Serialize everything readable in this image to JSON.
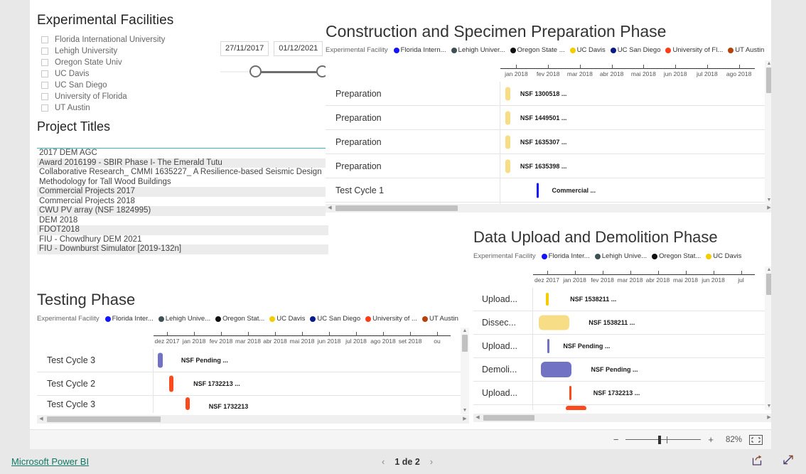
{
  "facilities_slicer": {
    "title": "Experimental Facilities",
    "items": [
      {
        "label": "Florida International University",
        "checked": false
      },
      {
        "label": "Lehigh University",
        "checked": false
      },
      {
        "label": "Oregon State Univ",
        "checked": false
      },
      {
        "label": "UC Davis",
        "checked": false
      },
      {
        "label": "UC San Diego",
        "checked": false
      },
      {
        "label": "University of Florida",
        "checked": false
      },
      {
        "label": "UT Austin",
        "checked": false
      }
    ]
  },
  "date_slicer": {
    "start_date": "27/11/2017",
    "end_date": "01/12/2021"
  },
  "project_titles": {
    "title": "Project Titles",
    "items": [
      "2017 DEM AGC",
      "Award 2016199 - SBIR Phase I- The Emerald Tutu",
      "Collaborative Research_ CMMI 1635227_ A Resilience-based Seismic Design Methodology for Tall Wood Buildings",
      "Commercial Projects 2017",
      "Commercial Projects 2018",
      "CWU PV array (NSF 1824995)",
      "DEM 2018",
      "FDOT2018",
      "FIU - Chowdhury DEM 2021",
      "FIU - Downburst Simulator [2019-132n]"
    ]
  },
  "legend_colors": {
    "florida_international": "#1414ff",
    "lehigh": "#3d5155",
    "oregon_state": "#111111",
    "uc_davis": "#f3cd00",
    "uc_san_diego": "#0a1a8c",
    "university_of_florida": "#fc3c17",
    "ut_austin": "#b5420a",
    "bar_yellow": "#f7de86",
    "bar_blue": "#1414ff",
    "bar_purple": "#7272c4",
    "bar_orange": "#fc4a1f"
  },
  "construction_chart": {
    "title": "Construction and Specimen Preparation Phase",
    "legend_caption": "Experimental Facility",
    "legend": [
      {
        "label": "Florida Intern...",
        "color": "#1414ff"
      },
      {
        "label": "Lehigh Univer...",
        "color": "#3d5155"
      },
      {
        "label": "Oregon State ...",
        "color": "#111111"
      },
      {
        "label": "UC Davis",
        "color": "#f3cd00"
      },
      {
        "label": "UC San Diego",
        "color": "#0a1a8c"
      },
      {
        "label": "University of Fl...",
        "color": "#fc3c17"
      },
      {
        "label": "UT Austin",
        "color": "#b5420a"
      }
    ],
    "axis_ticks": [
      "jan 2018",
      "fev 2018",
      "mar 2018",
      "abr 2018",
      "mai 2018",
      "jun 2018",
      "jul 2018",
      "ago 2018"
    ],
    "rows": [
      {
        "task": "Preparation",
        "label": "NSF 1300518 ...",
        "color": "#f7de86",
        "left_pct": 2.0,
        "width_pct": 2.0
      },
      {
        "task": "Preparation",
        "label": "NSF 1449501 ...",
        "color": "#f7de86",
        "left_pct": 2.0,
        "width_pct": 2.0
      },
      {
        "task": "Preparation",
        "label": "NSF 1635307 ...",
        "color": "#f7de86",
        "left_pct": 2.0,
        "width_pct": 2.0
      },
      {
        "task": "Preparation",
        "label": "NSF 1635398 ...",
        "color": "#f7de86",
        "left_pct": 2.0,
        "width_pct": 2.0
      },
      {
        "task": "Test Cycle 1",
        "label": "Commercial ...",
        "color": "#1414ff",
        "left_pct": 13.5,
        "width_pct": 0.9
      }
    ]
  },
  "upload_chart": {
    "title": "Data Upload and Demolition Phase",
    "legend_caption": "Experimental Facility",
    "legend": [
      {
        "label": "Florida Inter...",
        "color": "#1414ff"
      },
      {
        "label": "Lehigh Unive...",
        "color": "#3d5155"
      },
      {
        "label": "Oregon Stat...",
        "color": "#111111"
      },
      {
        "label": "UC Davis",
        "color": "#f3cd00"
      }
    ],
    "axis_ticks": [
      "dez 2017",
      "jan 2018",
      "fev 2018",
      "mar 2018",
      "abr 2018",
      "mai 2018",
      "jun 2018",
      "jul"
    ],
    "rows": [
      {
        "task": "Upload...",
        "label": "NSF 1538211 ...",
        "color": "#f3cd00",
        "left_pct": 3.5,
        "width_pct": 0.6
      },
      {
        "task": "Dissec...",
        "label": "NSF 1538211 ...",
        "color": "#f7de86",
        "left_pct": 1.5,
        "width_pct": 6.0
      },
      {
        "task": "Upload...",
        "label": "NSF Pending ...",
        "color": "#7272c4",
        "left_pct": 3.8,
        "width_pct": 0.7
      },
      {
        "task": "Demoli...",
        "label": "NSF Pending ...",
        "color": "#7272c4",
        "left_pct": 2.0,
        "width_pct": 6.5
      },
      {
        "task": "Upload...",
        "label": "NSF 1732213 ...",
        "color": "#fc4a1f",
        "left_pct": 9.5,
        "width_pct": 0.6
      }
    ]
  },
  "testing_chart": {
    "title": "Testing Phase",
    "legend_caption": "Experimental Facility",
    "legend": [
      {
        "label": "Florida Inter...",
        "color": "#1414ff"
      },
      {
        "label": "Lehigh Unive...",
        "color": "#3d5155"
      },
      {
        "label": "Oregon Stat...",
        "color": "#111111"
      },
      {
        "label": "UC Davis",
        "color": "#f3cd00"
      },
      {
        "label": "UC San Diego",
        "color": "#0a1a8c"
      },
      {
        "label": "University of ...",
        "color": "#fc3c17"
      },
      {
        "label": "UT Austin",
        "color": "#b5420a"
      }
    ],
    "axis_ticks": [
      "dez 2017",
      "jan 2018",
      "fev 2018",
      "mar 2018",
      "abr 2018",
      "mai 2018",
      "jun 2018",
      "jul 2018",
      "ago 2018",
      "set 2018",
      "ou"
    ],
    "rows": [
      {
        "task": "Test Cycle 3",
        "label": "NSF Pending ...",
        "color": "#7272c4",
        "left_pct": 1.0,
        "width_pct": 1.7
      },
      {
        "task": "Test Cycle 2",
        "label": "NSF 1732213 ...",
        "color": "#fc4a1f",
        "left_pct": 4.0,
        "width_pct": 1.5
      },
      {
        "task": "Test Cycle 3",
        "label": "NSF 1732213",
        "color": "#fc4a1f",
        "left_pct": 9.0,
        "width_pct": 1.5
      }
    ]
  },
  "zoom_bar": {
    "minus": "−",
    "plus": "+",
    "percent": "82%",
    "fit_icon": "fit-to-page-icon"
  },
  "footer": {
    "powerbi_label": "Microsoft Power BI",
    "prev_icon": "chevron-left-icon",
    "page_label": "1 de 2",
    "next_icon": "chevron-right-icon",
    "share_icon": "share-icon",
    "fullscreen_icon": "fullscreen-icon"
  }
}
